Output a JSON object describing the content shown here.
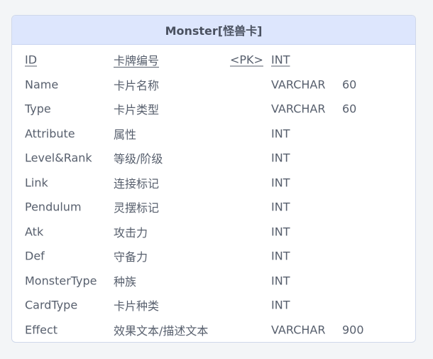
{
  "entity": {
    "title": "Monster[怪兽卡]",
    "fields": [
      {
        "name": "ID",
        "label": "卡牌编号",
        "key": "<PK>",
        "type": "INT",
        "size": ""
      },
      {
        "name": "Name",
        "label": "卡片名称",
        "key": "",
        "type": "VARCHAR",
        "size": "60"
      },
      {
        "name": "Type",
        "label": "卡片类型",
        "key": "",
        "type": "VARCHAR",
        "size": "60"
      },
      {
        "name": "Attribute",
        "label": "属性",
        "key": "",
        "type": "INT",
        "size": ""
      },
      {
        "name": "Level&Rank",
        "label": "等级/阶级",
        "key": "",
        "type": "INT",
        "size": ""
      },
      {
        "name": "Link",
        "label": "连接标记",
        "key": "",
        "type": "INT",
        "size": ""
      },
      {
        "name": "Pendulum",
        "label": "灵摆标记",
        "key": "",
        "type": "INT",
        "size": ""
      },
      {
        "name": "Atk",
        "label": "攻击力",
        "key": "",
        "type": "INT",
        "size": ""
      },
      {
        "name": "Def",
        "label": "守备力",
        "key": "",
        "type": "INT",
        "size": ""
      },
      {
        "name": "MonsterType",
        "label": "种族",
        "key": "",
        "type": "INT",
        "size": ""
      },
      {
        "name": "CardType",
        "label": "卡片种类",
        "key": "",
        "type": "INT",
        "size": ""
      },
      {
        "name": "Effect",
        "label": "效果文本/描述文本",
        "key": "",
        "type": "VARCHAR",
        "size": "900"
      }
    ]
  }
}
